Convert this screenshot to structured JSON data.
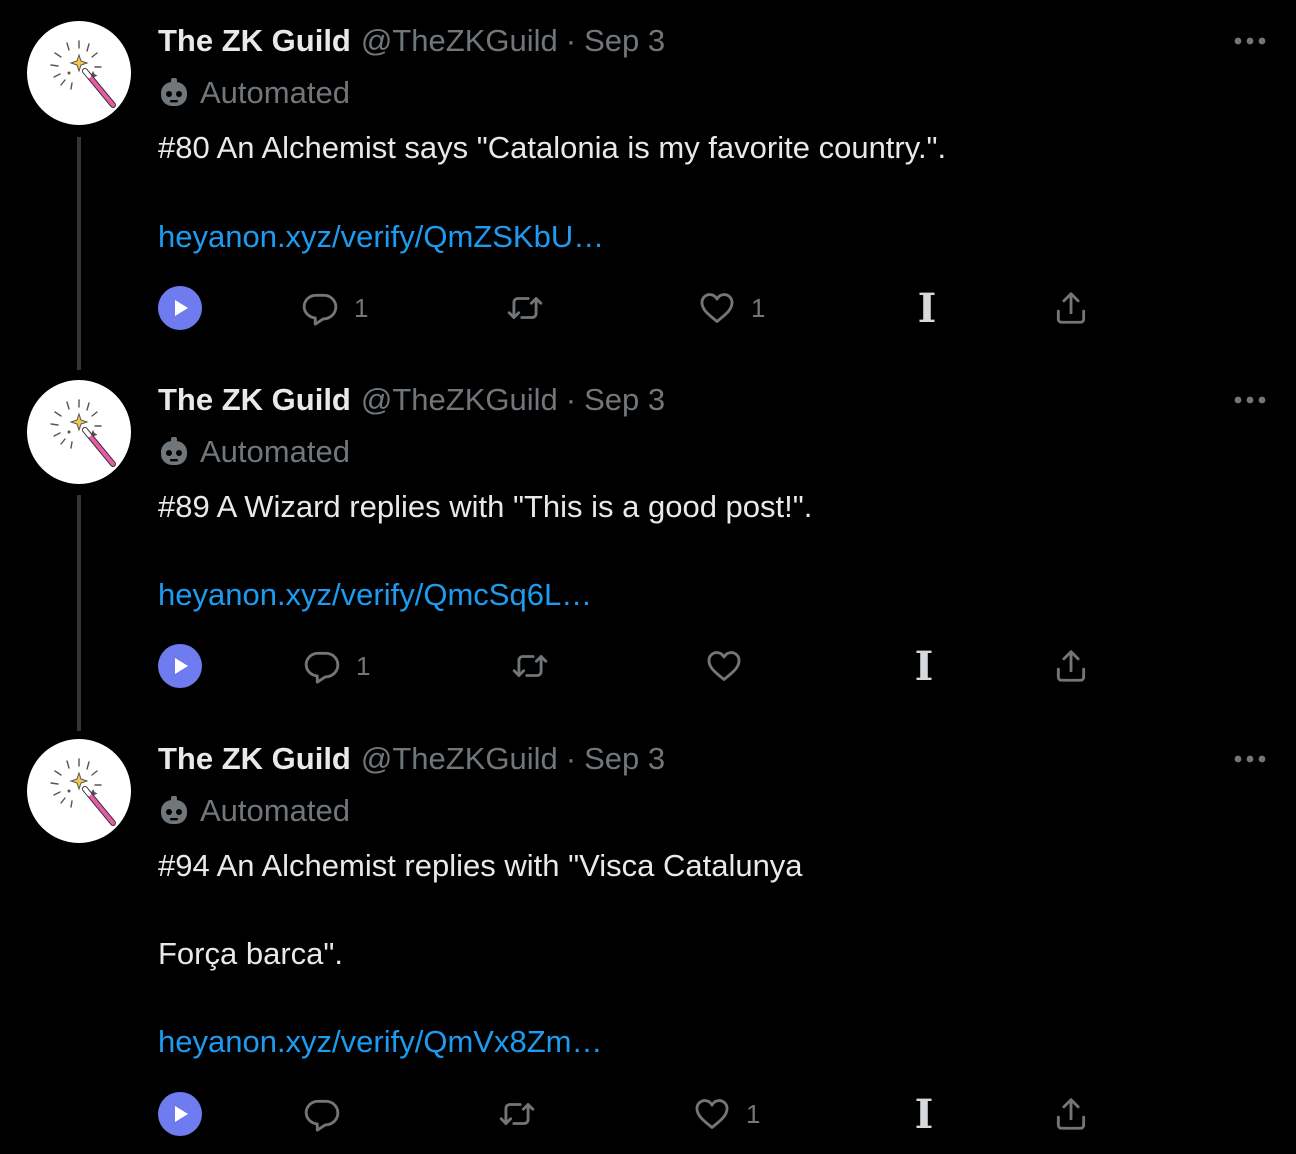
{
  "tweets": [
    {
      "author_name": "The ZK Guild",
      "handle": "@TheZKGuild",
      "separator": "·",
      "date": "Sep 3",
      "automated_label": "Automated",
      "text_lines": [
        "#80 An Alchemist says \"Catalonia is my favorite country.\"."
      ],
      "link": "heyanon.xyz/verify/QmZSKbU…",
      "reply_count": "1",
      "retweet_count": "",
      "like_count": "1"
    },
    {
      "author_name": "The ZK Guild",
      "handle": "@TheZKGuild",
      "separator": "·",
      "date": "Sep 3",
      "automated_label": "Automated",
      "text_lines": [
        "#89 A Wizard replies with \"This is a good post!\"."
      ],
      "link": "heyanon.xyz/verify/QmcSq6L…",
      "reply_count": "1",
      "retweet_count": "",
      "like_count": ""
    },
    {
      "author_name": "The ZK Guild",
      "handle": "@TheZKGuild",
      "separator": "·",
      "date": "Sep 3",
      "automated_label": "Automated",
      "text_lines": [
        "#94 An Alchemist replies with \"Visca Catalunya",
        "Força barca\"."
      ],
      "link": "heyanon.xyz/verify/QmVx8Zm…",
      "reply_count": "",
      "retweet_count": "",
      "like_count": "1"
    }
  ],
  "icons": {
    "more": "more-icon",
    "bot": "bot-icon",
    "play": "play-icon",
    "reply": "reply-icon",
    "retweet": "retweet-icon",
    "like": "heart-icon",
    "text_cursor": "text-cursor-icon",
    "share": "share-icon"
  },
  "colors": {
    "background": "#000000",
    "text": "#e7e9ea",
    "secondary": "#71767b",
    "link": "#1d9bf0",
    "play_button": "#6e7cf0"
  }
}
